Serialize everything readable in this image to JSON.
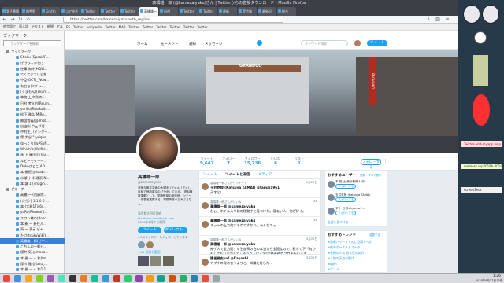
{
  "window": {
    "title": "高橋雄一郎 (@kamezaiyaku)さん | Twitterからの直接ダウンロード - Mozilla Firefox"
  },
  "tabs": [
    "電子書籍",
    "稿雪野",
    "Grotth",
    "コア統合",
    "Twitter",
    "Twitter",
    "Twitter",
    "高橋雄一",
    "新規",
    "Twitter",
    "Twitter",
    "最新",
    "受信箱",
    "最新記",
    "総合"
  ],
  "url": "https://twitter.com/kamezaiyaku/with_replies",
  "bookmarks_bar": [
    "他言語で",
    "同人誌",
    "テキスト",
    "新規",
    "アル",
    "ES",
    "Twitter",
    "wikipedia",
    "Twitter",
    "MAP",
    "Twitter",
    "Twitter",
    "Twitter",
    "Twitter",
    "Twitter",
    "Twitter"
  ],
  "sidebar": {
    "title": "ブックマーク",
    "search_placeholder": "ブックマークを検索",
    "items": [
      {
        "label": "ブックマーク",
        "type": "folder"
      },
      {
        "label": "Shoku (Speak/R...",
        "type": "item"
      },
      {
        "label": "ばばひっか次に...",
        "type": "item"
      },
      {
        "label": "仕事 海外(HQW...",
        "type": "item"
      },
      {
        "label": "てくてきていどあ...",
        "type": "item"
      },
      {
        "label": "中臣(OCT)_Wow...",
        "type": "item"
      },
      {
        "label": "有名な(ミチュ...",
        "type": "item"
      },
      {
        "label": "(くまもん)[ekum...",
        "type": "item"
      },
      {
        "label": "本物 上 特別の...",
        "type": "item"
      },
      {
        "label": "日村 考え方[Reum...",
        "type": "item"
      },
      {
        "label": "yuriko(Rieakai)(...",
        "type": "item"
      },
      {
        "label": "松下 雅弘[MiRe...",
        "type": "item"
      },
      {
        "label": "郷談雪義(@imob...",
        "type": "item"
      },
      {
        "label": "自由駅 ウェブ対...",
        "type": "item"
      },
      {
        "label": "中村生_ (インター...",
        "type": "item"
      },
      {
        "label": "第 大谷(\"Lyrique...",
        "type": "item"
      },
      {
        "label": "ゆっくり(@PSoN...",
        "type": "item"
      },
      {
        "label": "Which's(Wolfhl...",
        "type": "item"
      },
      {
        "label": "永 上 藤田(ryTcu...",
        "type": "item"
      },
      {
        "label": "ルビーモリーー...",
        "type": "item"
      },
      {
        "label": "Dukeはどこ[AD...",
        "type": "item"
      },
      {
        "label": "本 雅紀(@rbabr...",
        "type": "item"
      },
      {
        "label": "水瀬 十 料理雨(Ni...",
        "type": "item"
      },
      {
        "label": "本 講 1 (imagin...",
        "type": "item"
      },
      {
        "label": "グループ",
        "type": "folder"
      },
      {
        "label": "高橋 一 (内藤院...",
        "type": "item"
      },
      {
        "label": "(たら) [ 1.1 0 0 ...",
        "type": "item"
      },
      {
        "label": "本 (大雅1Tiv6s...",
        "type": "item"
      },
      {
        "label": "yoRo(Rieakai)(...",
        "type": "item"
      },
      {
        "label": "スワン様の(dood...",
        "type": "item"
      },
      {
        "label": "本 新 ー 新任人...",
        "type": "item"
      },
      {
        "label": "高 ー 表示 ピ+...",
        "type": "item"
      },
      {
        "label": "たけ(tsukuWikiY...",
        "type": "item"
      },
      {
        "label": "高橋雄一郎(ビや...",
        "type": "item"
      },
      {
        "label": "こちんの一般ビ...",
        "type": "item"
      },
      {
        "label": "横井 気(@moda...",
        "type": "item"
      },
      {
        "label": "本 雅 一 + 和(Im...",
        "type": "item"
      },
      {
        "label": "深川 雅 信(aru_...",
        "type": "item"
      },
      {
        "label": "本 雅 一 + 和1 1...",
        "type": "item"
      },
      {
        "label": "本 雅紀 上 の 1...",
        "type": "item"
      },
      {
        "label": "平野(本人 名前)...",
        "type": "item"
      },
      {
        "label": "中野(ねこ の T...",
        "type": "item"
      }
    ]
  },
  "twitter": {
    "nav": [
      "ホーム",
      "モーメント",
      "通知",
      "メッセージ"
    ],
    "search_placeholder": "キーワード検索",
    "tweet_button": "ツイート",
    "banner_sign": "GRANDUO",
    "banner_sign2": "PACHINKO",
    "stats": [
      {
        "label": "ツイート",
        "value": "9,647"
      },
      {
        "label": "フォロー",
        "value": "7"
      },
      {
        "label": "フォロワー",
        "value": "15,736"
      },
      {
        "label": "いいね",
        "value": "6"
      },
      {
        "label": "リスト",
        "value": "1"
      }
    ],
    "follow_button": "フォローする",
    "profile": {
      "name": "高橋雄一郎",
      "handle": "@kamezaiyaku",
      "bio": "非医な無芸芸術の大隅手 (マイメリアイ) 、自前で他新事文の「全出」ている。 資料教育運動として、学陸教育の新評価、ツイート非表者推薦する、電視事態のひみぶるなん。",
      "location": "東京都大田区調布",
      "website": "facebook.com/Ryuk-trex...",
      "joined": "2010年2月から利用",
      "tweet_btn": "ツイート",
      "message_btn": "ダイレクト...",
      "followers_you_know": "1人のフォロワーもフォローしています",
      "photos_label": "1,01 画像と動画"
    },
    "tabs": [
      "ツイート",
      "ツイートと返信",
      "メディア"
    ],
    "tweets": [
      {
        "rt": "高橋雄一郎さんがリツイート",
        "name": "玉井克哉 (Katsuya TAMAI) @tamai1961",
        "date": "5月20日",
        "text": "天才と！"
      },
      {
        "rt": "高橋雄一郎さんがいいね",
        "name": "高橋雄一郎 @kamezaiyaku",
        "date": "4h",
        "text": "おぉ、ホテル入り前の移動中に見つけた。寝ない人、何が好く。"
      },
      {
        "rt": "",
        "name": "高橋雄一郎 @kamezaiyaku",
        "date": "4h",
        "text": "ネットの上で何するのですかね。みんなでっ"
      },
      {
        "rt": "高橋雄一郎さんがいいね",
        "name": "高橋雄一郎 @kamezaiyaku",
        "date": "5月20日",
        "text": "神ゲ人で全方面する生産系の白の本当から全国なので、教えて下「何かもしてもいいかんて」そうな人は人学(学修義務のコロを行います。"
      },
      {
        "rt": "",
        "name": "護者雅史kof @Kayoshi...",
        "date": "5月20日",
        "text": "アプチの月の言うよりと、知識に対した..."
      }
    ],
    "who_to_follow": {
      "title": "おすすめユーザー",
      "refresh": "更新・すべて表示",
      "users": [
        {
          "name": "本 雄 士  東京都新人 @...",
          "btn": "フォローする"
        },
        {
          "name": "玉井克哉 (Katsuya TAMA)",
          "btn": "フォローする"
        },
        {
          "name": "すぐ 日  @ohyama1...",
          "btn": "フォローする"
        }
      ],
      "find_friends": "友達を見つける"
    },
    "trends": {
      "title": "おすすめトレンド",
      "change": "変更する",
      "items": [
        "#忍者ハットリくんに登場すべき",
        "#他のボーナステストの...",
        "#各種の人気 ある日の気分",
        "#人物の天気の朝は",
        "#ggm",
        "#アニメ"
      ]
    }
  },
  "right_panel": {
    "notes": [
      "Twitter-add-myapp.wnp.lt",
      "memory rep2018b-2018",
      "screenShot"
    ]
  },
  "taskbar": {
    "time": "1:26",
    "date": "2018年9月17日 午後"
  },
  "colors": {
    "twitter_blue": "#1da1f2",
    "sidebar_selected": "#3b7fd8",
    "tab_bar": "#3c3f46"
  }
}
